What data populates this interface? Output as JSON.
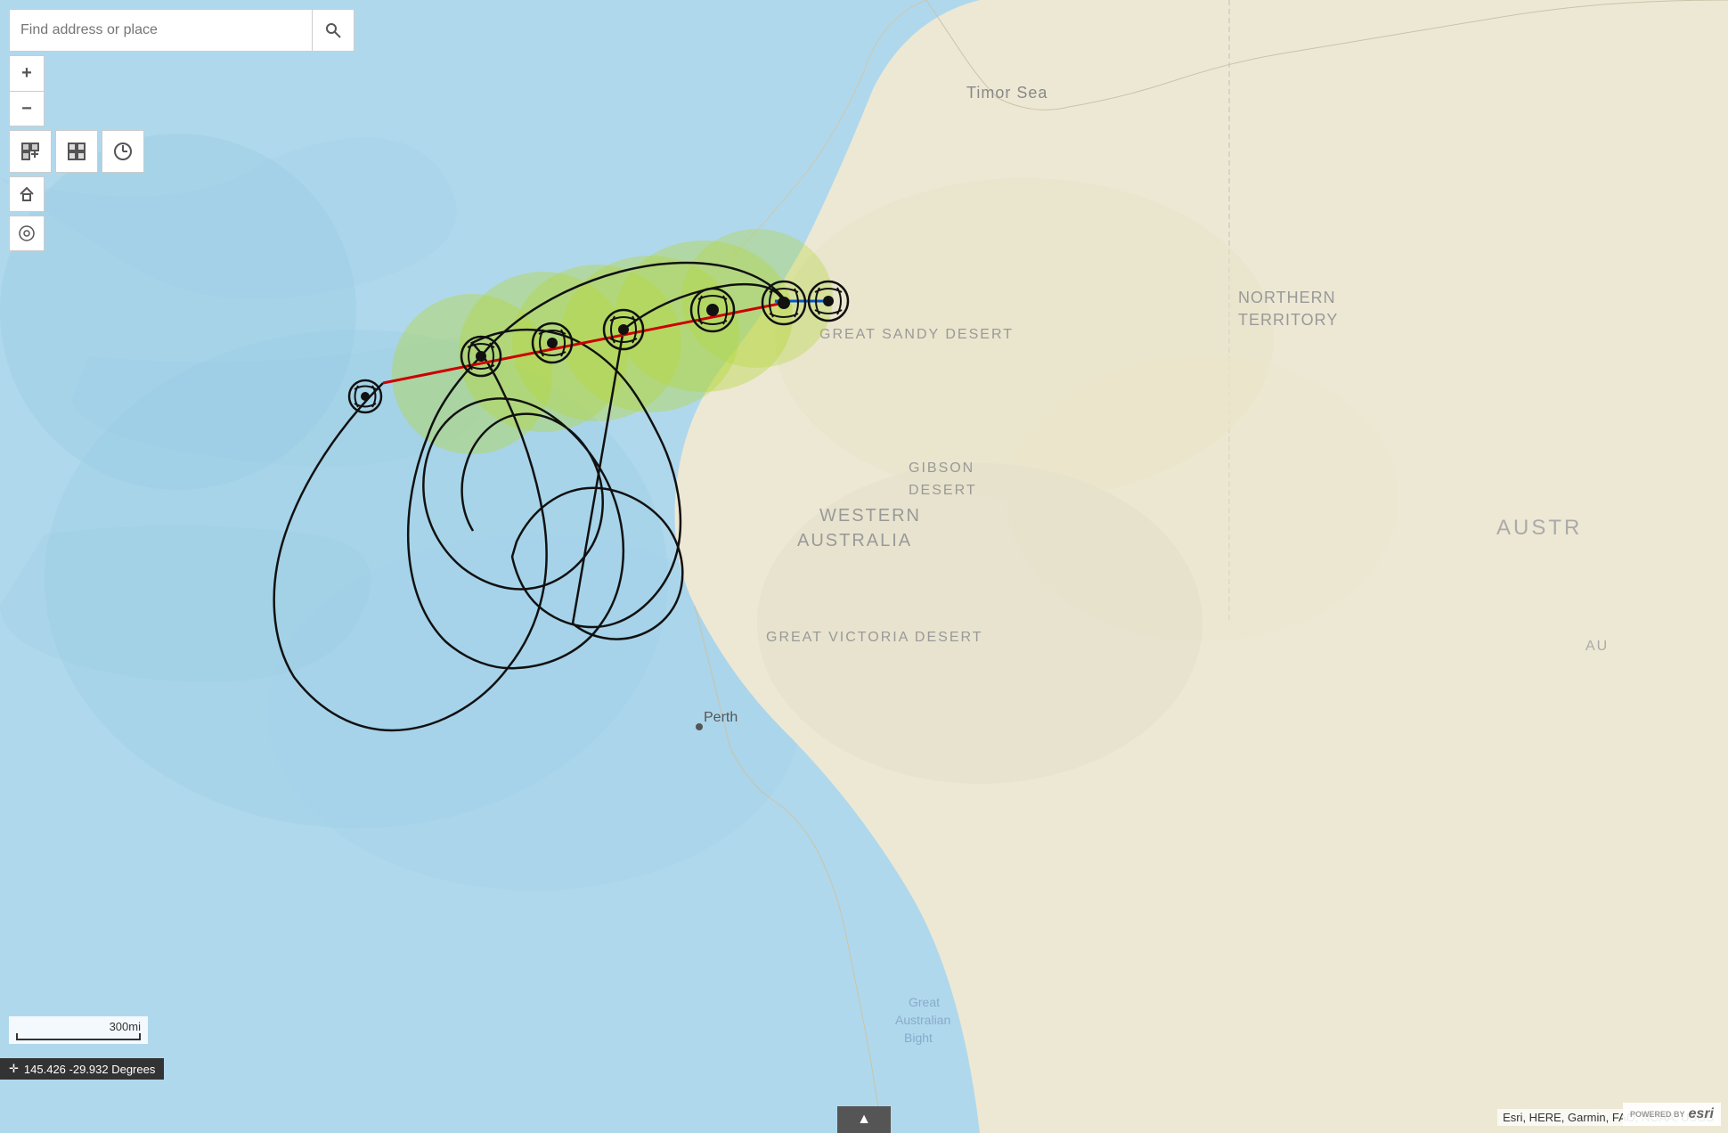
{
  "toolbar": {
    "search_placeholder": "Find address or place",
    "search_btn_label": "🔍",
    "zoom_in_label": "+",
    "zoom_out_label": "−",
    "basemap_label": "⊞",
    "layers_label": "🏔",
    "time_label": "⏱",
    "home_label": "⌂",
    "compass_label": "◎"
  },
  "scale": {
    "label": "300mi",
    "ruler_width": 140
  },
  "coordinates": {
    "icon": "✛",
    "value": "145.426 -29.932 Degrees"
  },
  "attribution": {
    "text": "Esri, HERE, Garmin, FAO, NOAA, USGS"
  },
  "esri_badge": {
    "label": "POWERED BY esri"
  },
  "map_labels": {
    "timor_sea": "Timor Sea",
    "great_sandy_desert": "GREAT SANDY DESERT",
    "northern_territory": "NORTHERN\nTERRITORY",
    "gibson_desert": "GIBSON\nDESERT",
    "western_australia": "WESTERN\nAUSTRALIA",
    "great_victoria_desert": "GREAT VICTORIA DESERT",
    "austr": "AUSTR",
    "perth": "Perth",
    "great_australian_bight": "Great\nAustralian\nBight"
  },
  "colors": {
    "ocean": "#a8d8ea",
    "deep_ocean": "#8dc3d8",
    "land": "#f0ede0",
    "land_desert": "#e8e4d0",
    "cyclone_track_past": "#cc0000",
    "cyclone_track_future": "#0055cc",
    "cyclone_loop": "#111111",
    "uncertainty_cone": "rgba(180,210,80,0.45)"
  }
}
